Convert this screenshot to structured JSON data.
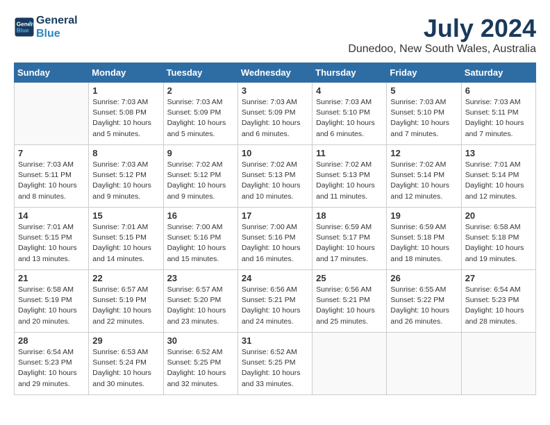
{
  "logo": {
    "line1": "General",
    "line2": "Blue"
  },
  "title": "July 2024",
  "subtitle": "Dunedoo, New South Wales, Australia",
  "days_of_week": [
    "Sunday",
    "Monday",
    "Tuesday",
    "Wednesday",
    "Thursday",
    "Friday",
    "Saturday"
  ],
  "weeks": [
    [
      {
        "day": "",
        "info": ""
      },
      {
        "day": "1",
        "info": "Sunrise: 7:03 AM\nSunset: 5:08 PM\nDaylight: 10 hours\nand 5 minutes."
      },
      {
        "day": "2",
        "info": "Sunrise: 7:03 AM\nSunset: 5:09 PM\nDaylight: 10 hours\nand 5 minutes."
      },
      {
        "day": "3",
        "info": "Sunrise: 7:03 AM\nSunset: 5:09 PM\nDaylight: 10 hours\nand 6 minutes."
      },
      {
        "day": "4",
        "info": "Sunrise: 7:03 AM\nSunset: 5:10 PM\nDaylight: 10 hours\nand 6 minutes."
      },
      {
        "day": "5",
        "info": "Sunrise: 7:03 AM\nSunset: 5:10 PM\nDaylight: 10 hours\nand 7 minutes."
      },
      {
        "day": "6",
        "info": "Sunrise: 7:03 AM\nSunset: 5:11 PM\nDaylight: 10 hours\nand 7 minutes."
      }
    ],
    [
      {
        "day": "7",
        "info": "Sunrise: 7:03 AM\nSunset: 5:11 PM\nDaylight: 10 hours\nand 8 minutes."
      },
      {
        "day": "8",
        "info": "Sunrise: 7:03 AM\nSunset: 5:12 PM\nDaylight: 10 hours\nand 9 minutes."
      },
      {
        "day": "9",
        "info": "Sunrise: 7:02 AM\nSunset: 5:12 PM\nDaylight: 10 hours\nand 9 minutes."
      },
      {
        "day": "10",
        "info": "Sunrise: 7:02 AM\nSunset: 5:13 PM\nDaylight: 10 hours\nand 10 minutes."
      },
      {
        "day": "11",
        "info": "Sunrise: 7:02 AM\nSunset: 5:13 PM\nDaylight: 10 hours\nand 11 minutes."
      },
      {
        "day": "12",
        "info": "Sunrise: 7:02 AM\nSunset: 5:14 PM\nDaylight: 10 hours\nand 12 minutes."
      },
      {
        "day": "13",
        "info": "Sunrise: 7:01 AM\nSunset: 5:14 PM\nDaylight: 10 hours\nand 12 minutes."
      }
    ],
    [
      {
        "day": "14",
        "info": "Sunrise: 7:01 AM\nSunset: 5:15 PM\nDaylight: 10 hours\nand 13 minutes."
      },
      {
        "day": "15",
        "info": "Sunrise: 7:01 AM\nSunset: 5:15 PM\nDaylight: 10 hours\nand 14 minutes."
      },
      {
        "day": "16",
        "info": "Sunrise: 7:00 AM\nSunset: 5:16 PM\nDaylight: 10 hours\nand 15 minutes."
      },
      {
        "day": "17",
        "info": "Sunrise: 7:00 AM\nSunset: 5:16 PM\nDaylight: 10 hours\nand 16 minutes."
      },
      {
        "day": "18",
        "info": "Sunrise: 6:59 AM\nSunset: 5:17 PM\nDaylight: 10 hours\nand 17 minutes."
      },
      {
        "day": "19",
        "info": "Sunrise: 6:59 AM\nSunset: 5:18 PM\nDaylight: 10 hours\nand 18 minutes."
      },
      {
        "day": "20",
        "info": "Sunrise: 6:58 AM\nSunset: 5:18 PM\nDaylight: 10 hours\nand 19 minutes."
      }
    ],
    [
      {
        "day": "21",
        "info": "Sunrise: 6:58 AM\nSunset: 5:19 PM\nDaylight: 10 hours\nand 20 minutes."
      },
      {
        "day": "22",
        "info": "Sunrise: 6:57 AM\nSunset: 5:19 PM\nDaylight: 10 hours\nand 22 minutes."
      },
      {
        "day": "23",
        "info": "Sunrise: 6:57 AM\nSunset: 5:20 PM\nDaylight: 10 hours\nand 23 minutes."
      },
      {
        "day": "24",
        "info": "Sunrise: 6:56 AM\nSunset: 5:21 PM\nDaylight: 10 hours\nand 24 minutes."
      },
      {
        "day": "25",
        "info": "Sunrise: 6:56 AM\nSunset: 5:21 PM\nDaylight: 10 hours\nand 25 minutes."
      },
      {
        "day": "26",
        "info": "Sunrise: 6:55 AM\nSunset: 5:22 PM\nDaylight: 10 hours\nand 26 minutes."
      },
      {
        "day": "27",
        "info": "Sunrise: 6:54 AM\nSunset: 5:23 PM\nDaylight: 10 hours\nand 28 minutes."
      }
    ],
    [
      {
        "day": "28",
        "info": "Sunrise: 6:54 AM\nSunset: 5:23 PM\nDaylight: 10 hours\nand 29 minutes."
      },
      {
        "day": "29",
        "info": "Sunrise: 6:53 AM\nSunset: 5:24 PM\nDaylight: 10 hours\nand 30 minutes."
      },
      {
        "day": "30",
        "info": "Sunrise: 6:52 AM\nSunset: 5:25 PM\nDaylight: 10 hours\nand 32 minutes."
      },
      {
        "day": "31",
        "info": "Sunrise: 6:52 AM\nSunset: 5:25 PM\nDaylight: 10 hours\nand 33 minutes."
      },
      {
        "day": "",
        "info": ""
      },
      {
        "day": "",
        "info": ""
      },
      {
        "day": "",
        "info": ""
      }
    ]
  ]
}
